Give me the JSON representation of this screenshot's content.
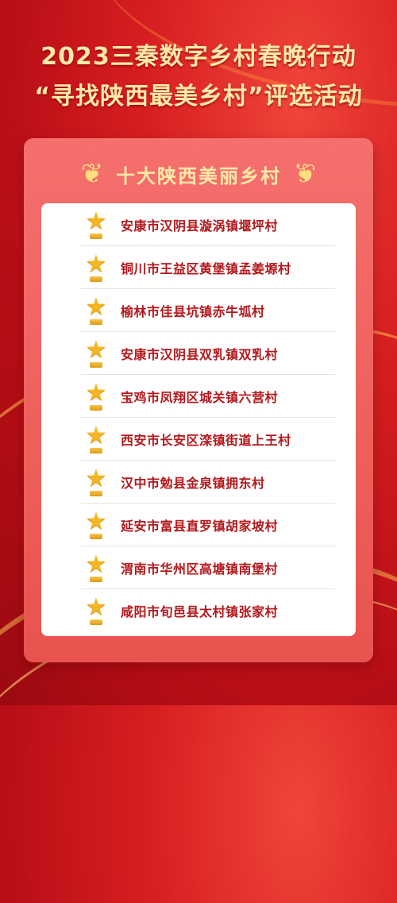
{
  "header": {
    "line1": "2023三秦数字乡村春晚行动",
    "line2": "“寻找陕西最美乡村”评选活动"
  },
  "card": {
    "title": "十大陕西美丽乡村",
    "items": [
      "安康市汉阴县漩涡镇堰坪村",
      "铜川市王益区黄堡镇孟姜塬村",
      "榆林市佳县坑镇赤牛坬村",
      "安康市汉阴县双乳镇双乳村",
      "宝鸡市凤翔区城关镇六营村",
      "西安市长安区滦镇街道上王村",
      "汉中市勉县金泉镇拥东村",
      "延安市富县直罗镇胡家坡村",
      "渭南市华州区高塘镇南堡村",
      "咸阳市旬邑县太村镇张家村"
    ]
  },
  "icons": {
    "trophy": "star-trophy-icon",
    "laurel": "laurel-icon"
  },
  "colors": {
    "background": "#d81f22",
    "gold_text": "#ffe9a8",
    "card": "#ef5f5b",
    "item_text": "#b3171b",
    "star": "#f4b623"
  }
}
